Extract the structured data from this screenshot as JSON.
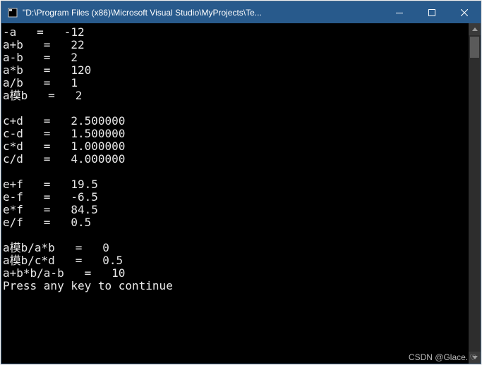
{
  "window": {
    "title": "\"D:\\Program Files (x86)\\Microsoft Visual Studio\\MyProjects\\Te..."
  },
  "console": {
    "lines": [
      "-a   =   -12",
      "a+b   =   22",
      "a-b   =   2",
      "a*b   =   120",
      "a/b   =   1",
      "a模b   =   2",
      "",
      "c+d   =   2.500000",
      "c-d   =   1.500000",
      "c*d   =   1.000000",
      "c/d   =   4.000000",
      "",
      "e+f   =   19.5",
      "e-f   =   -6.5",
      "e*f   =   84.5",
      "e/f   =   0.5",
      "",
      "a模b/a*b   =   0",
      "a模b/c*d   =   0.5",
      "a+b*b/a-b   =   10",
      "Press any key to continue"
    ]
  },
  "watermark": {
    "text": "CSDN @Glace."
  }
}
